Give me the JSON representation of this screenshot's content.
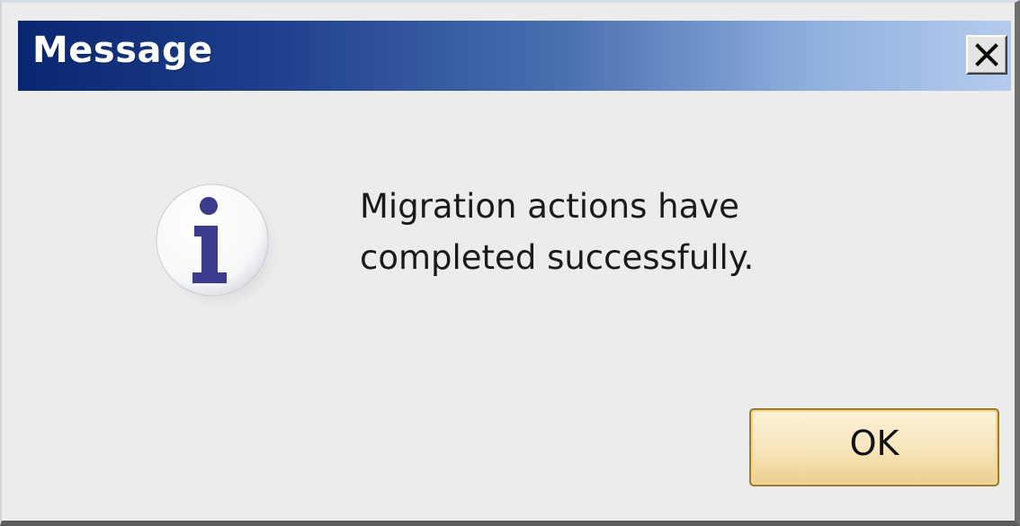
{
  "window": {
    "title": "Message"
  },
  "titlebar": {
    "close_icon": "close-icon",
    "close_label": "X"
  },
  "content": {
    "icon": "information-icon",
    "message_lines": [
      "Migration actions have",
      "completed successfully."
    ]
  },
  "buttons": {
    "ok_label": "OK"
  },
  "colors": {
    "titlebar_start": "#0b2670",
    "titlebar_end": "#b5cbee",
    "dialog_background": "#ececec",
    "icon_glyph": "#3b3a8c",
    "ok_button_border": "#9a7b34"
  }
}
